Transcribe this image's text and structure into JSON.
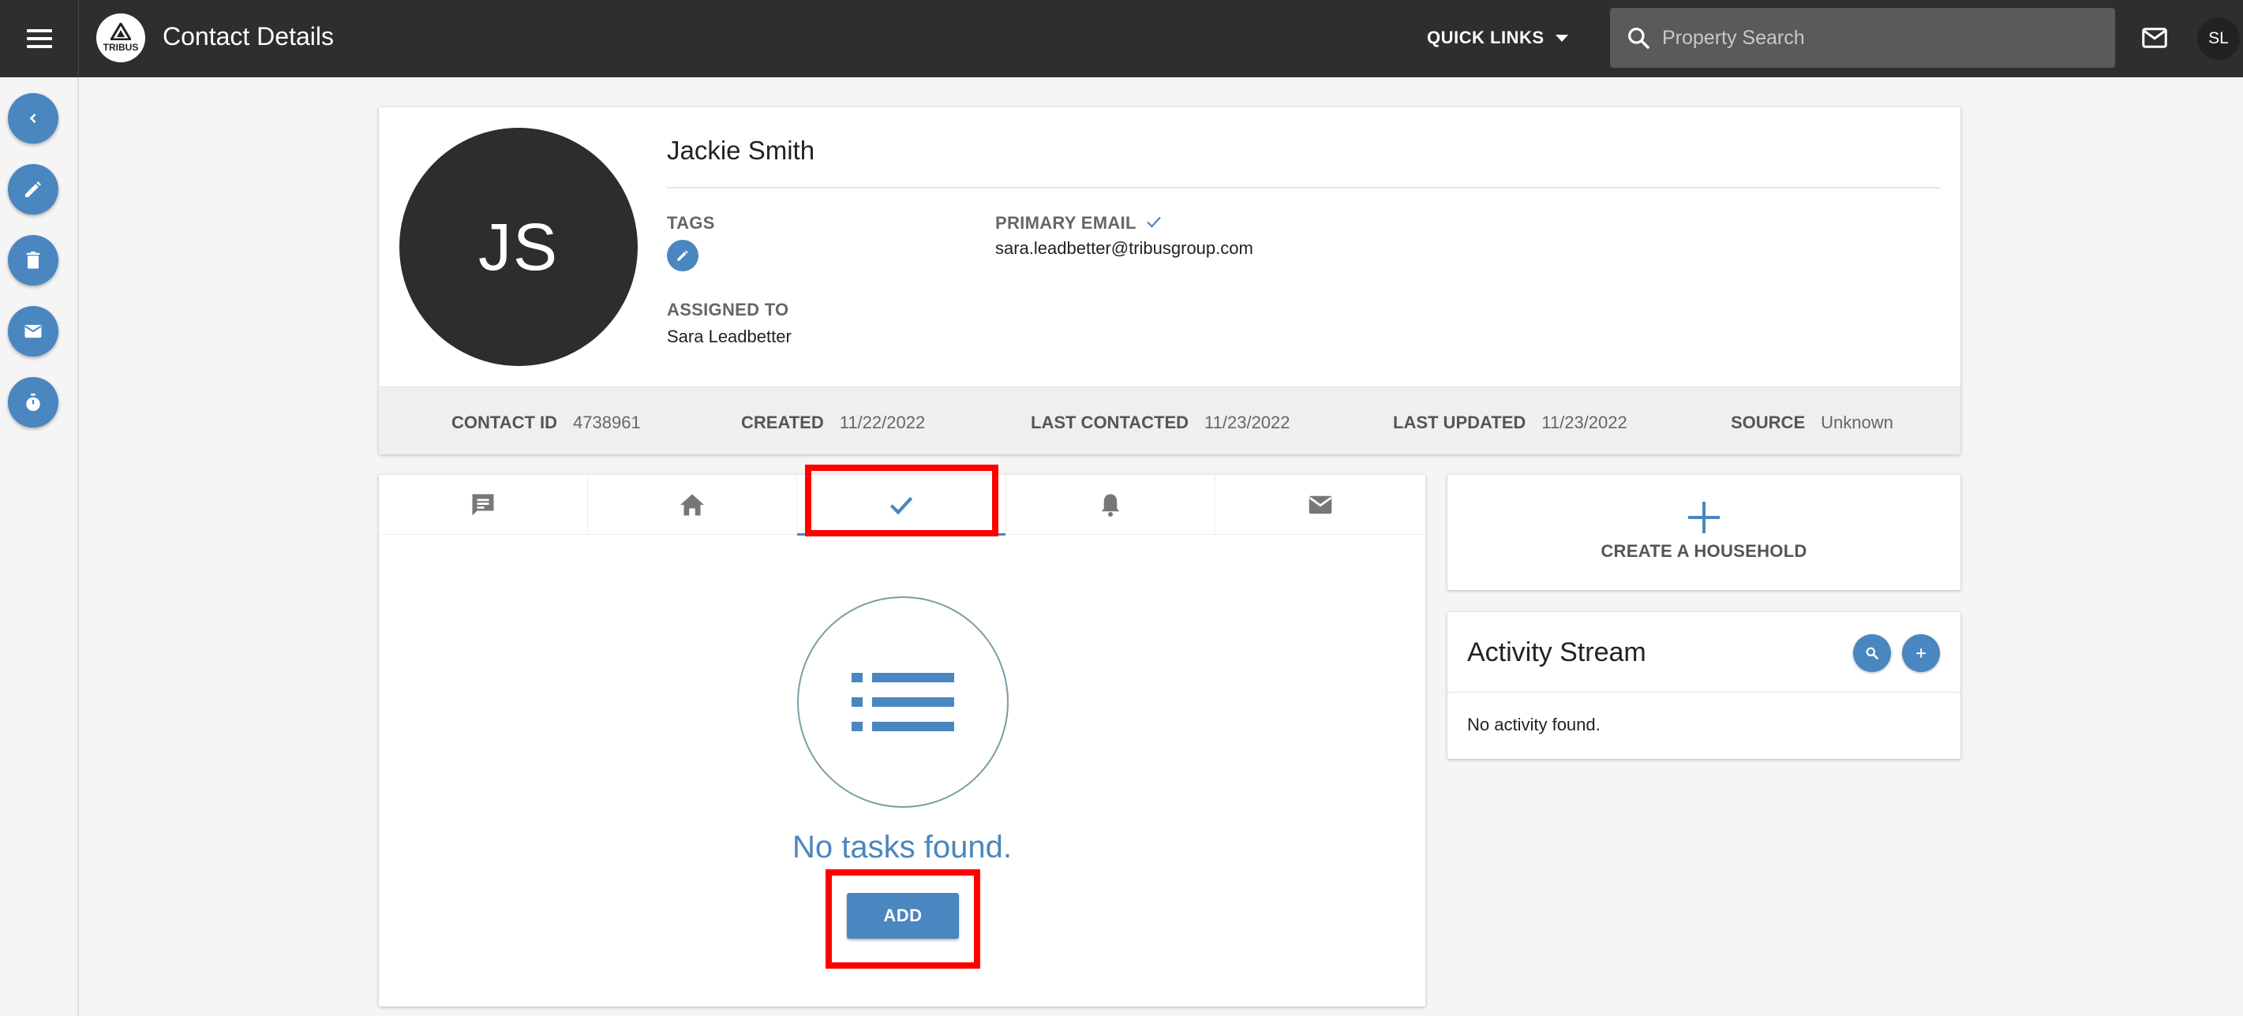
{
  "topbar": {
    "app_title": "Contact Details",
    "logo_text": "TRIBUS",
    "quick_links_label": "QUICK LINKS",
    "search_placeholder": "Property Search",
    "user_initials": "SL"
  },
  "rail": {
    "items": [
      {
        "icon": "chevron-left-icon"
      },
      {
        "icon": "pencil-icon"
      },
      {
        "icon": "trash-icon"
      },
      {
        "icon": "mail-icon"
      },
      {
        "icon": "stopwatch-icon"
      }
    ]
  },
  "contact": {
    "initials": "JS",
    "name": "Jackie Smith",
    "tags_label": "TAGS",
    "primary_email_label": "PRIMARY EMAIL",
    "primary_email": "sara.leadbetter@tribusgroup.com",
    "assigned_to_label": "ASSIGNED TO",
    "assigned_to": "Sara Leadbetter",
    "meta": {
      "contact_id_label": "CONTACT ID",
      "contact_id": "4738961",
      "created_label": "CREATED",
      "created": "11/22/2022",
      "last_contacted_label": "LAST CONTACTED",
      "last_contacted": "11/23/2022",
      "last_updated_label": "LAST UPDATED",
      "last_updated": "11/23/2022",
      "source_label": "SOURCE",
      "source": "Unknown"
    }
  },
  "tasks": {
    "tabs": [
      {
        "icon": "notes-icon"
      },
      {
        "icon": "home-icon"
      },
      {
        "icon": "check-icon",
        "active": true
      },
      {
        "icon": "bell-icon"
      },
      {
        "icon": "mail-icon"
      }
    ],
    "empty_text": "No tasks found.",
    "add_label": "ADD"
  },
  "household": {
    "label": "CREATE A HOUSEHOLD"
  },
  "activity": {
    "title": "Activity Stream",
    "empty_text": "No activity found."
  },
  "colors": {
    "accent": "#4a86c0",
    "topbar": "#2e2e2e",
    "highlight": "#ff0000"
  }
}
